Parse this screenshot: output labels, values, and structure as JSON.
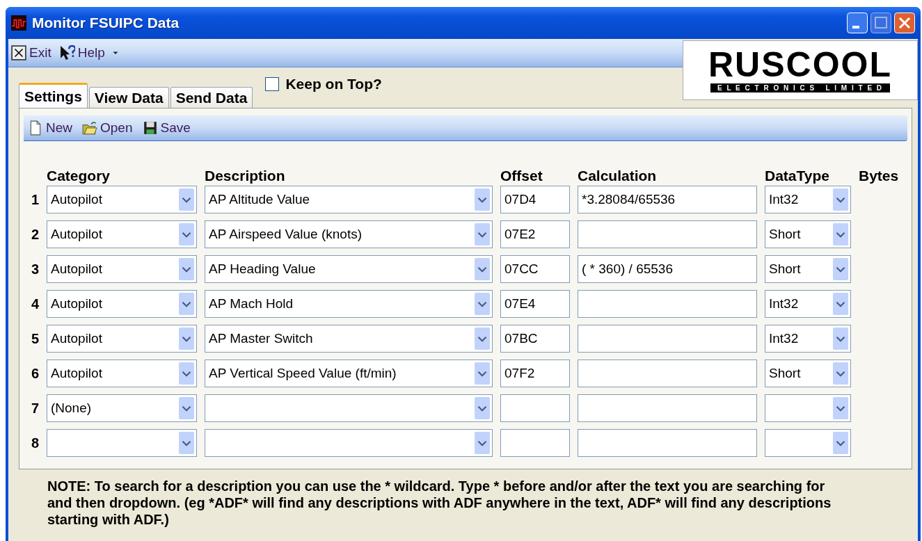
{
  "window": {
    "title": "Monitor FSUIPC Data"
  },
  "menu": [
    {
      "label": "Exit"
    },
    {
      "label": "Help"
    }
  ],
  "logo": {
    "name": "RUSCOOL",
    "tagline": "E L E C T R O N I C S   L I M I T E D"
  },
  "keep_on_top": {
    "label": "Keep on Top?",
    "checked": false
  },
  "tabs": [
    {
      "label": "Settings",
      "selected": true
    },
    {
      "label": "View Data",
      "selected": false
    },
    {
      "label": "Send Data",
      "selected": false
    }
  ],
  "toolbar": [
    {
      "label": "New"
    },
    {
      "label": "Open"
    },
    {
      "label": "Save"
    }
  ],
  "columns": [
    "Category",
    "Description",
    "Offset",
    "Calculation",
    "DataType",
    "Bytes"
  ],
  "rows": [
    {
      "number": "1",
      "category": "Autopilot",
      "description": "AP Altitude Value",
      "offset": "07D4",
      "calculation": "*3.28084/65536",
      "datatype": "Int32"
    },
    {
      "number": "2",
      "category": "Autopilot",
      "description": "AP Airspeed Value (knots)",
      "offset": "07E2",
      "datatype": "Short"
    },
    {
      "number": "3",
      "category": "Autopilot",
      "description": "AP Heading Value",
      "offset": "07CC",
      "calculation": "( * 360) / 65536",
      "datatype": "Short"
    },
    {
      "number": "4",
      "category": "Autopilot",
      "description": "AP Mach Hold",
      "offset": "07E4",
      "datatype": "Int32"
    },
    {
      "number": "5",
      "category": "Autopilot",
      "description": "AP Master Switch",
      "offset": "07BC",
      "datatype": "Int32"
    },
    {
      "number": "6",
      "category": "Autopilot",
      "description": "AP Vertical Speed Value (ft/min)",
      "offset": "07F2",
      "datatype": "Short"
    },
    {
      "number": "7",
      "category": "(None)"
    },
    {
      "number": "8"
    }
  ],
  "note": "NOTE: To search for a description you can use the * wildcard.  Type * before and/or after the text you are searching for and then dropdown.  (eg *ADF* will find any descriptions with ADF anywhere in the text, ADF* will find any descriptions starting with ADF.)"
}
